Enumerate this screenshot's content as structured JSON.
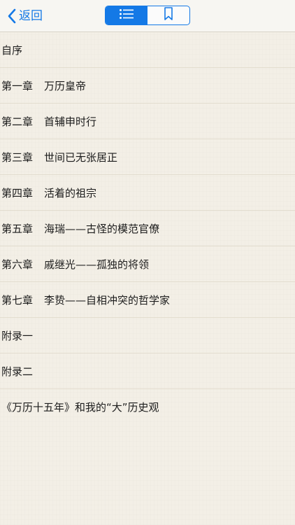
{
  "nav": {
    "back_label": "返回",
    "segments": [
      {
        "name": "contents",
        "icon": "list-icon",
        "active": true
      },
      {
        "name": "bookmarks",
        "icon": "bookmark-icon",
        "active": false
      }
    ]
  },
  "colors": {
    "accent": "#1479e6",
    "paper": "#f3efe6",
    "divider": "#e3ddcf"
  },
  "toc": {
    "items": [
      {
        "chapter": "自序",
        "title": ""
      },
      {
        "chapter": "第一章",
        "title": "万历皇帝"
      },
      {
        "chapter": "第二章",
        "title": "首辅申时行"
      },
      {
        "chapter": "第三章",
        "title": "世间已无张居正"
      },
      {
        "chapter": "第四章",
        "title": "活着的祖宗"
      },
      {
        "chapter": "第五章",
        "title": "海瑞——古怪的模范官僚"
      },
      {
        "chapter": "第六章",
        "title": "戚继光——孤独的将领"
      },
      {
        "chapter": "第七章",
        "title": "李贽——自相冲突的哲学家"
      },
      {
        "chapter": "附录一",
        "title": ""
      },
      {
        "chapter": "附录二",
        "title": ""
      },
      {
        "chapter": "《万历十五年》和我的“大”历史观",
        "title": ""
      }
    ]
  }
}
